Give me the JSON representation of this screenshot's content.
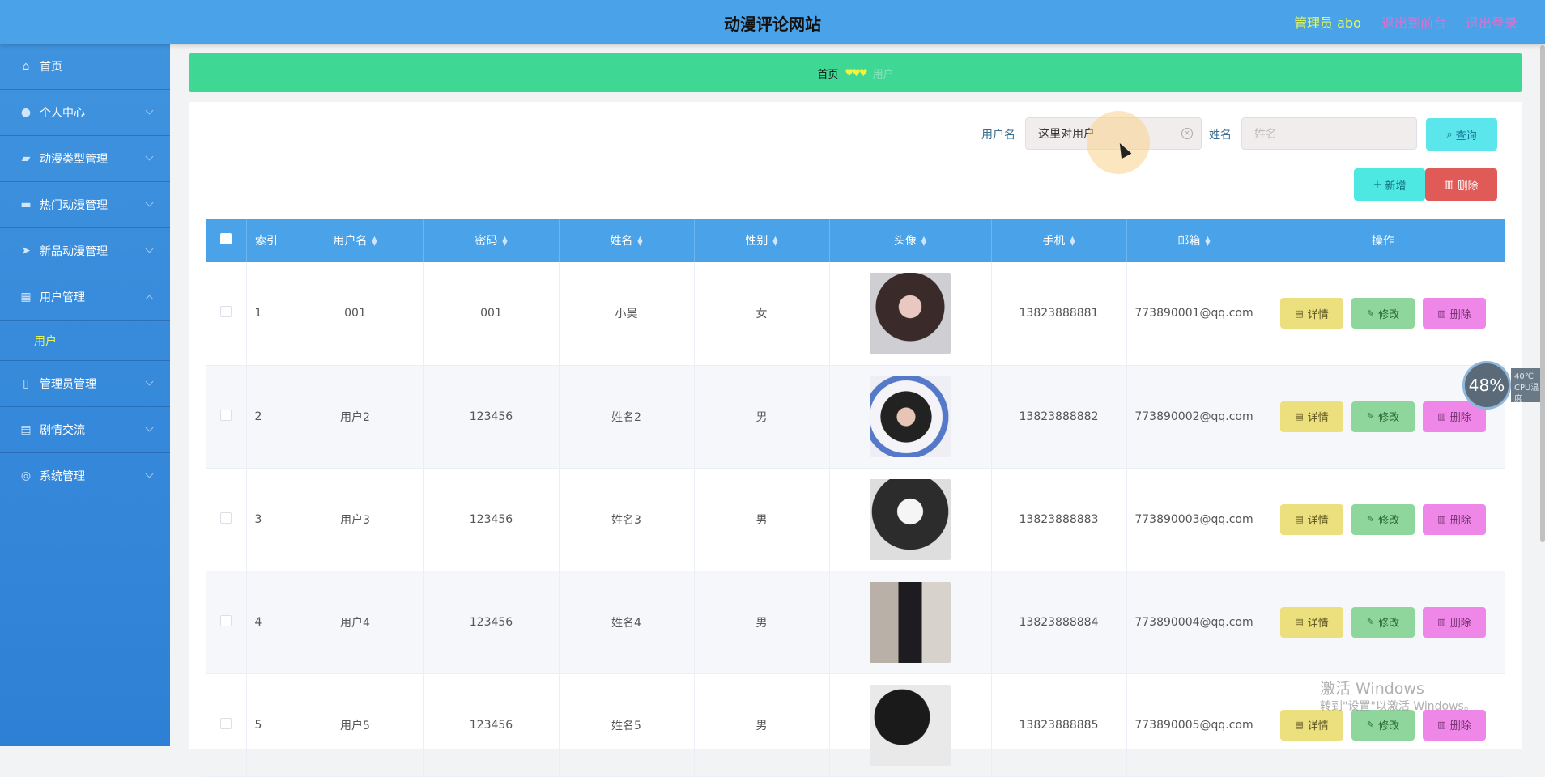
{
  "header": {
    "title": "动漫评论网站",
    "admin_label": "管理员 abo",
    "to_front": "退出到前台",
    "logout": "退出登录"
  },
  "sidebar": {
    "items": [
      {
        "label": "首页",
        "icon": "home-icon"
      },
      {
        "label": "个人中心",
        "icon": "user-icon"
      },
      {
        "label": "动漫类型管理",
        "icon": "category-icon"
      },
      {
        "label": "热门动漫管理",
        "icon": "briefcase-icon"
      },
      {
        "label": "新品动漫管理",
        "icon": "send-icon"
      },
      {
        "label": "用户管理",
        "icon": "grid-icon"
      },
      {
        "label": "管理员管理",
        "icon": "phone-icon"
      },
      {
        "label": "剧情交流",
        "icon": "chat-icon"
      },
      {
        "label": "系统管理",
        "icon": "settings-icon"
      }
    ],
    "submenu_user": "用户"
  },
  "breadcrumb": {
    "home": "首页",
    "hearts": "♥♥♥",
    "current": "用户"
  },
  "search": {
    "username_label": "用户名",
    "username_value": "这里对用户",
    "name_label": "姓名",
    "name_placeholder": "姓名",
    "query_button": "查询"
  },
  "actions": {
    "add": "新增",
    "delete": "删除"
  },
  "table": {
    "headers": [
      "索引",
      "用户名",
      "密码",
      "姓名",
      "性别",
      "头像",
      "手机",
      "邮箱",
      "操作"
    ],
    "rows": [
      {
        "index": "1",
        "username": "001",
        "password": "001",
        "name": "小吴",
        "gender": "女",
        "phone": "13823888881",
        "email": "773890001@qq.com"
      },
      {
        "index": "2",
        "username": "用户2",
        "password": "123456",
        "name": "姓名2",
        "gender": "男",
        "phone": "13823888882",
        "email": "773890002@qq.com"
      },
      {
        "index": "3",
        "username": "用户3",
        "password": "123456",
        "name": "姓名3",
        "gender": "男",
        "phone": "13823888883",
        "email": "773890003@qq.com"
      },
      {
        "index": "4",
        "username": "用户4",
        "password": "123456",
        "name": "姓名4",
        "gender": "男",
        "phone": "13823888884",
        "email": "773890004@qq.com"
      },
      {
        "index": "5",
        "username": "用户5",
        "password": "123456",
        "name": "姓名5",
        "gender": "男",
        "phone": "13823888885",
        "email": "773890005@qq.com"
      }
    ],
    "op_detail": "详情",
    "op_edit": "修改",
    "op_delete": "删除"
  },
  "overlay": {
    "gauge": "48%",
    "temp": "40℃",
    "temp_label": "CPU温度",
    "windows_activate": "激活 Windows",
    "windows_hint": "转到\"设置\"以激活 Windows。"
  },
  "colors": {
    "header": "#4aa3e8",
    "sidebar": "#3a8ddc",
    "breadcrumb": "#3ed894",
    "accent_yellow": "#e6f65a"
  }
}
